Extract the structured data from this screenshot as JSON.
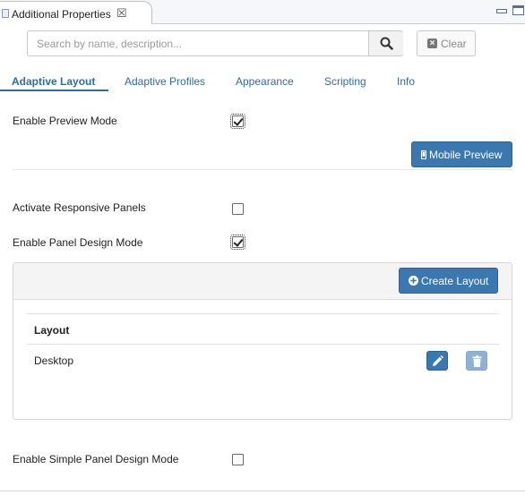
{
  "view_tab": {
    "title": "Additional Properties",
    "close_glyph": "☒"
  },
  "search": {
    "placeholder": "Search by name, description...",
    "value": "",
    "search_icon": "search-icon",
    "clear_label": "Clear",
    "clear_icon": "close-square-icon"
  },
  "tabs": [
    {
      "label": "Adaptive Layout",
      "active": true
    },
    {
      "label": "Adaptive Profiles",
      "active": false
    },
    {
      "label": "Appearance",
      "active": false
    },
    {
      "label": "Scripting",
      "active": false
    },
    {
      "label": "Info",
      "active": false
    }
  ],
  "settings": {
    "preview_mode": {
      "label": "Enable Preview Mode",
      "checked": true
    },
    "mobile_preview_label": "Mobile Preview",
    "mobile_preview_icon": "mobile-icon",
    "responsive_panels": {
      "label": "Activate Responsive Panels",
      "checked": false
    },
    "panel_design_mode": {
      "label": "Enable Panel Design Mode",
      "checked": true
    },
    "simple_panel_design_mode": {
      "label": "Enable Simple Panel Design Mode",
      "checked": false
    }
  },
  "layout_panel": {
    "create_label": "Create Layout",
    "create_icon": "plus-circle-icon",
    "column_header": "Layout",
    "rows": [
      {
        "name": "Desktop",
        "edit_icon": "pencil-icon",
        "delete_icon": "trash-icon"
      }
    ]
  },
  "colors": {
    "accent": "#3b78b0",
    "link": "#2e6da4",
    "disabled_button": "#8fb2d3"
  }
}
